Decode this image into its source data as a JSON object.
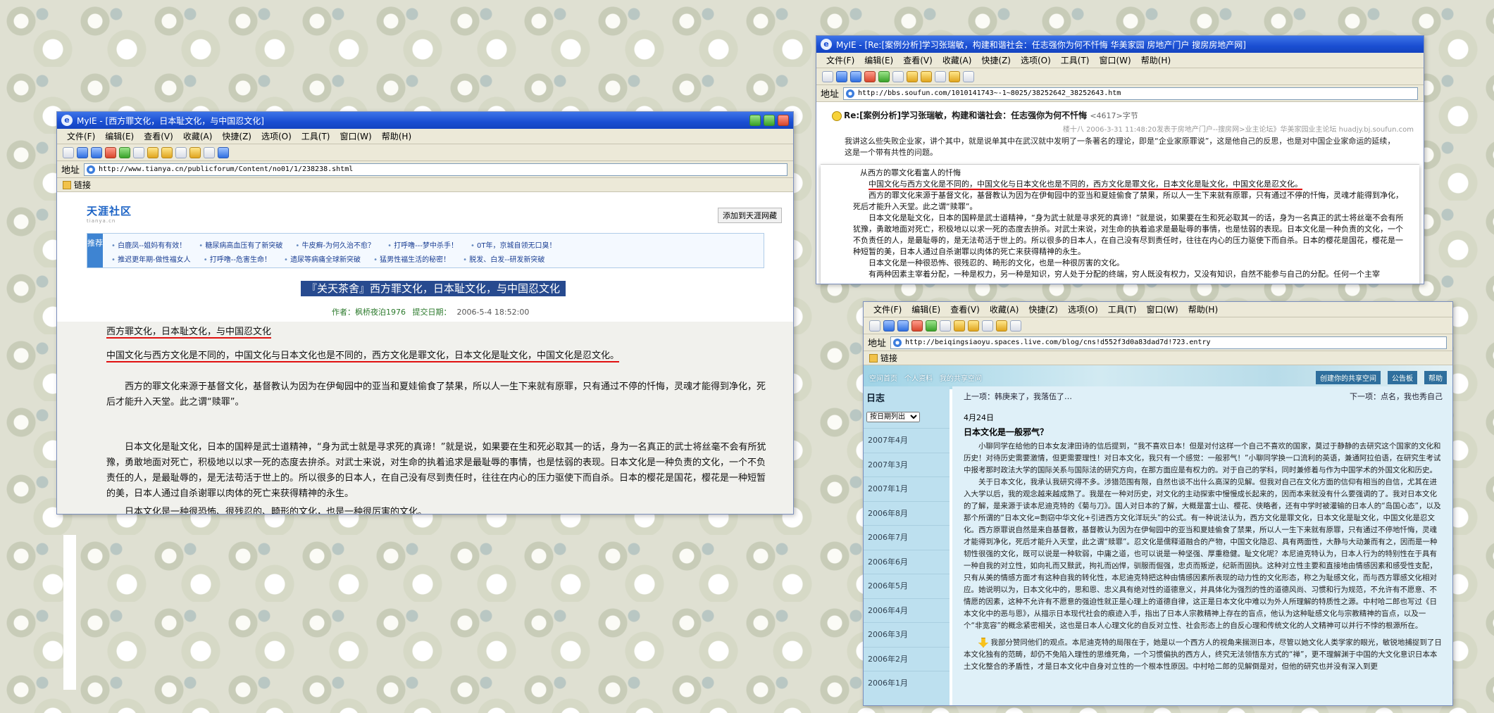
{
  "win1": {
    "title": "MyIE - [西方罪文化，日本耻文化，与中国忍文化]",
    "menu": [
      "文件(F)",
      "编辑(E)",
      "查看(V)",
      "收藏(A)",
      "快捷(Z)",
      "选项(O)",
      "工具(T)",
      "窗口(W)",
      "帮助(H)"
    ],
    "address_label": "地址",
    "url": "http://www.tianya.cn/publicforum/Content/no01/1/238238.shtml",
    "links_label": "链接",
    "site_logo": "天涯社区",
    "site_logo_sub": "tianya.cn",
    "fav_button": "添加到天涯网藏",
    "rec_label": "推荐",
    "rec_row1": [
      "白鹿凤--姐妈有有效！",
      "糖尿病高血压有了新突破",
      "牛皮癣-为何久治不愈？",
      "打呼噜---梦中杀手！",
      "0T年，京城自领无口臭！"
    ],
    "rec_row2": [
      "推迟更年期-做性福女人",
      "打呼噜--危害生命！",
      "遗尿等病痛全球新突破",
      "猛男性福生活的秘密！",
      "脱发、白发--研发新突破"
    ],
    "headline": "『关天茶舍』西方罪文化，日本耻文化，与中国忍文化",
    "author_label": "作者：",
    "author": "枫桥夜泊1976",
    "date_label": "提交日期：",
    "date": "2006-5-4 18:52:00",
    "p1": "西方罪文化，日本耻文化，与中国忍文化",
    "p2": "中国文化与西方文化是不同的，中国文化与日本文化也是不同的，西方文化是罪文化，日本文化是耻文化，中国文化是忍文化。",
    "p3": "西方的罪文化来源于基督文化，基督教认为因为在伊甸园中的亚当和夏娃偷食了禁果，所以人一生下来就有原罪，只有通过不停的忏悔，灵魂才能得到净化，死后才能升入天堂。此之谓“赎罪”。",
    "p4": "日本文化是耻文化，日本的国粹是武士道精神，“身为武士就是寻求死的真谛！”就是说，如果要在生和死必取其一的话，身为一名真正的武士将丝毫不会有所犹豫，勇敢地面对死亡，积极地以以求一死的态度去拚杀。对武士来说，对生命的执着追求是最耻辱的事情，也是怯弱的表现。日本文化是一种负责的文化，一个不负责任的人，是最耻辱的，是无法苟活于世上的。所以很多的日本人，在自己没有尽到责任时，往往在内心的压力驱使下而自杀。日本的樱花是国花，樱花是一种短暂的美，日本人通过自杀谢罪以肉体的死亡来获得精神的永生。",
    "p5": "日本文化是一种很恐怖、很残忍的、畸形的文化，也是一种很厉害的文化。"
  },
  "win2": {
    "title": "MyIE - [Re:[案例分析]学习张瑞敏，构建和谐社会：任志强你为何不忏悔 华美家园 房地产门户 搜房房地产网]",
    "menu": [
      "文件(F)",
      "编辑(E)",
      "查看(V)",
      "收藏(A)",
      "快捷(Z)",
      "选项(O)",
      "工具(T)",
      "窗口(W)",
      "帮助(H)"
    ],
    "address_label": "地址",
    "url": "http://bbs.soufun.com/1010141743~-1~8025/38252642_38252643.htm",
    "post_title": "Re:[案例分析]学习张瑞敏，构建和谐社会：任志强你为何不忏悔",
    "post_title_sub": "<4617>字节",
    "post_meta": "楼十八  2006-3-31 11:48:20发表于房地产门户--搜房网>业主论坛》华美家园业主论坛 huadjy.bj.soufun.com",
    "post_body": "我讲这么些失败企业家，讲个其中，就是说单其中在武汉就中发明了一条著名的理论，即是“企业家原罪说”，这是他自己的反思，也是对中国企业家命运的延续，这是一个带有共性的问题。",
    "ov_line0": "从西方的罪文化看富人的忏悔",
    "ov_p1": "中国文化与西方文化是不同的，中国文化与日本文化也是不同的，西方文化是罪文化，日本文化是耻文化，中国文化是忍文化。",
    "ov_p2": "西方的罪文化来源于基督文化，基督教认为因为在伊甸园中的亚当和夏娃偷食了禁果，所以人一生下来就有原罪，只有通过不停的忏悔，灵魂才能得到净化，死后才能升入天堂。此之谓“赎罪”。",
    "ov_p3": "日本文化是耻文化，日本的国粹是武士道精神，“身为武士就是寻求死的真谛！”就是说，如果要在生和死必取其一的话，身为一名真正的武士将丝毫不会有所犹豫，勇敢地面对死亡，积极地以以求一死的态度去拚杀。对武士来说，对生命的执着追求是最耻辱的事情，也是怯弱的表现。日本文化是一种负责的文化，一个不负责任的人，是最耻辱的，是无法苟活于世上的。所以很多的日本人，在自己没有尽到责任时，往往在内心的压力驱使下而自杀。日本的樱花是国花，樱花是一种短暂的美，日本人通过自杀谢罪以肉体的死亡来获得精神的永生。",
    "ov_p4": "日本文化是一种很恐怖、很残忍的、畸形的文化，也是一种很厉害的文化。",
    "ov_p5": "有两种因素主宰着分配，一种是权力，另一种是知识，穷人处于分配的终端，穷人既没有权力，又没有知识，自然不能参与自己的分配。任何一个主宰"
  },
  "win3": {
    "menu": [
      "文件(F)",
      "编辑(E)",
      "查看(V)",
      "收藏(A)",
      "快捷(Z)",
      "选项(O)",
      "工具(T)",
      "窗口(W)",
      "帮助(H)"
    ],
    "address_label": "地址",
    "url": "http://beiqingsiaoyu.spaces.live.com/blog/cns!d552f3d0a83dad7d!723.entry",
    "links_label": "链接",
    "top_links": [
      "空间首页",
      "个人资料",
      "我的共享空间",
      "创建你的共享空间",
      "公告板",
      "帮助"
    ],
    "sidebar_title": "日志",
    "sort_select": "按日期列出",
    "months": [
      "2007年4月",
      "2007年3月",
      "2007年1月",
      "2006年8月",
      "2006年7月",
      "2006年6月",
      "2006年5月",
      "2006年4月",
      "2006年3月",
      "2006年2月",
      "2006年1月"
    ],
    "prev": "上一项：韩庚来了，我落伍了…",
    "next": "下一项：点名，我也秀自己",
    "post_date": "4月24日",
    "post_title": "日本文化是一般邪气？",
    "p1": "小聊同学在给他的日本女友津田诗的信后提到，“我不喜欢日本！但是对付这样一个自己不喜欢的国家，莫过于静静的去研究这个国家的文化和历史！对待历史需要激情，但更需要理性！对日本文化，我只有一个感觉：一般邪气！”小聊同学换一口流利的英语，兼通阿拉伯语，在研究生考试中报考那时政法大学的国际关系与国际法的研究方向，在那方面应是有权力的。对于自己的学科，同时兼修着与作为中国学术的外国文化和历史。",
    "p2": "关于日本文化，我承认我研究得不多。涉猎范围有限，自然也谈不出什么高深的见解。但我对自己在文化方面的信仰有相当的自信，尤其在进入大学以后，我的观念越来越成熟了。我是在一种对历史，对文化的主动探索中慢慢成长起来的，因而本来就没有什么要强调的了。我对日本文化的了解，是来源于读本尼迪克特的《菊与刀》。国人对日本的了解，大概是富士山、樱花、侠略者，还有中学时被灌输的日本人的“岛国心态”，以及那个所谓的“日本文化=剽窃中华文化+引进西方文化洋玩头”的公式。有一种说法认为，西方文化是罪文化，日本文化是耻文化，中国文化是忍文化。西方原罪说自然是来自基督教，基督教认为因为在伊甸园中的亚当和夏娃偷食了禁果，所以人一生下来就有原罪，只有通过不停地忏悔，灵魂才能得到净化，死后才能升入天堂，此之谓“赎罪”。忍文化是儒释道融合的产物，中国文化隐忍、具有两面性，大静与大动兼而有之，因而是一种韧性很强的文化，既可以说是一种软弱，中庸之道，也可以说是一种坚强、厚重稳健。耻文化呢？本尼迪克特认为，日本人行为的特别性在于具有一种自我的对立性，如向礼而又黩武，拘礼而凶悍，驯服而倔强，忠贞而叛逆，纪新而固执。这种对立性主要和直接地由情感因素和感受性支配，只有从美的情感方面才有这种自我的转化性，本尼迪克特把这种由情感因素所表现的动力性的文化形态，称之为耻感文化，而与西方罪感文化相对应。她说明以为，日本文化中的，思和恩、忠义具有绝对性的道德意义，并具体化为强烈的性的道德风尚、习惯和行为规范，不允许有不愿意、不情愿的因素，这种不允许有不愿意的强迫性就正是心理上的道德自律，这正是日本文化中难以为外人所理解的特质性之源。中村哈二郎也写过《日本文化中的恶与恩》，从描示日本现代社会的痕迹入手，指出了日本人宗教精神上存在的盲点，他认为这种耻感文化与宗教精神的盲点，以及一个“非宽容”的概念紧密相关，这也是日本人心理文化的自反对立性、社会形态上的自反心理和传统文化的人文精神可以并行不悖的根源所在。",
    "p3": "我部分赞同他们的观点。本尼迪克特的局限在于，她是以一个西方人的视角来揣测日本，尽管以她文化人类学家的眼光，敏锐地捕捉到了日本文化独有的范畴，却仍不免陷入理性的思维死角，一个习惯偏执的西方人，终究无法领悟东方式的“禅”，更不理解渊于中国的大文化意识日本本土文化整合的矛盾性，才是日本文化中自身对立性的一个根本性原因。中村哈二郎的见解倒是对，但他的研究也并没有深入到更"
  }
}
